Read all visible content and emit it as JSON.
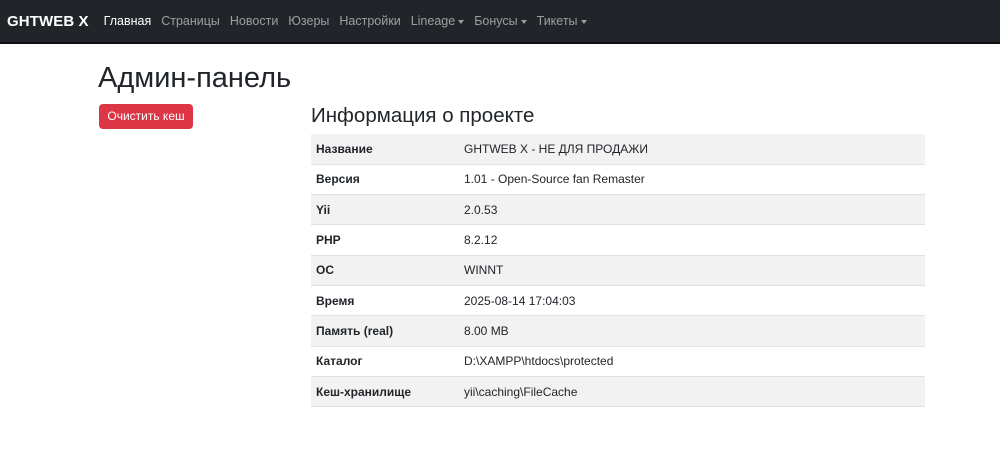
{
  "navbar": {
    "brand": "GHTWEB X",
    "items": [
      {
        "label": "Главная",
        "active": true,
        "dropdown": false
      },
      {
        "label": "Страницы",
        "active": false,
        "dropdown": false
      },
      {
        "label": "Новости",
        "active": false,
        "dropdown": false
      },
      {
        "label": "Юзеры",
        "active": false,
        "dropdown": false
      },
      {
        "label": "Настройки",
        "active": false,
        "dropdown": false
      },
      {
        "label": "Lineage",
        "active": false,
        "dropdown": true
      },
      {
        "label": "Бонусы",
        "active": false,
        "dropdown": true
      },
      {
        "label": "Тикеты",
        "active": false,
        "dropdown": true
      }
    ]
  },
  "page": {
    "title": "Админ-панель",
    "clear_cache_label": "Очистить кеш"
  },
  "project_info": {
    "title": "Информация о проекте",
    "rows": [
      {
        "key": "Название",
        "value": "GHTWEB X - НЕ ДЛЯ ПРОДАЖИ"
      },
      {
        "key": "Версия",
        "value": "1.01 - Open-Source fan Remaster"
      },
      {
        "key": "Yii",
        "value": "2.0.53"
      },
      {
        "key": "PHP",
        "value": "8.2.12"
      },
      {
        "key": "ОС",
        "value": "WINNT"
      },
      {
        "key": "Время",
        "value": "2025-08-14 17:04:03"
      },
      {
        "key": "Память (real)",
        "value": "8.00 MB"
      },
      {
        "key": "Каталог",
        "value": "D:\\XAMPP\\htdocs\\protected"
      },
      {
        "key": "Кеш-хранилище",
        "value": "yii\\caching\\FileCache"
      }
    ]
  },
  "colors": {
    "navbar_bg": "#212529",
    "danger": "#dc3545",
    "stripe": "#f2f2f2"
  }
}
